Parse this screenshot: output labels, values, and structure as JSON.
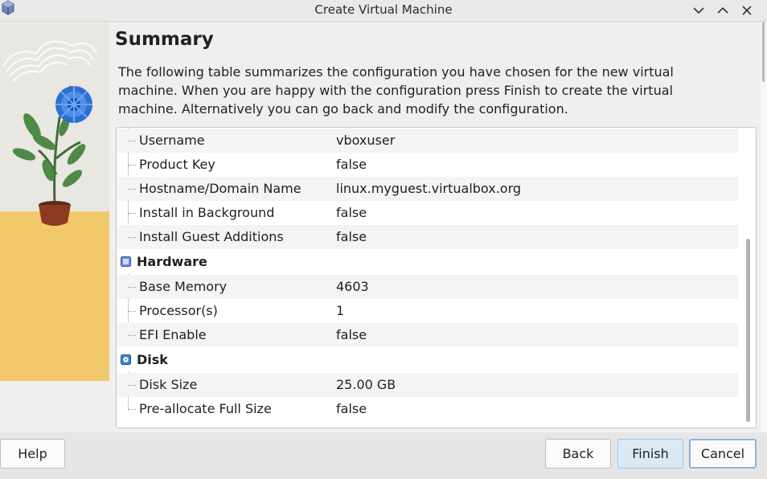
{
  "window": {
    "title": "Create Virtual Machine",
    "controls": [
      "minimize",
      "maximize",
      "close"
    ]
  },
  "page": {
    "heading": "Summary",
    "description": "The following table summarizes the configuration you have chosen for the new virtual machine. When you are happy with the configuration press Finish to create the virtual machine. Alternatively you can go back and modify the configuration."
  },
  "summary": {
    "unattended_rows": [
      {
        "key": "Username",
        "value": "vboxuser"
      },
      {
        "key": "Product Key",
        "value": "false"
      },
      {
        "key": "Hostname/Domain Name",
        "value": "linux.myguest.virtualbox.org"
      },
      {
        "key": "Install in Background",
        "value": "false"
      },
      {
        "key": "Install Guest Additions",
        "value": "false"
      }
    ],
    "hardware": {
      "label": "Hardware",
      "rows": [
        {
          "key": "Base Memory",
          "value": "4603"
        },
        {
          "key": "Processor(s)",
          "value": "1"
        },
        {
          "key": "EFI Enable",
          "value": "false"
        }
      ]
    },
    "disk": {
      "label": "Disk",
      "rows": [
        {
          "key": "Disk Size",
          "value": "25.00 GB"
        },
        {
          "key": "Pre-allocate Full Size",
          "value": "false"
        }
      ]
    }
  },
  "buttons": {
    "help": "Help",
    "back": "Back",
    "finish": "Finish",
    "cancel": "Cancel"
  },
  "colors": {
    "accent": "#8ab4dd",
    "finish_bg": "#dbe9f5",
    "illustration_yellow": "#f1c96a"
  }
}
